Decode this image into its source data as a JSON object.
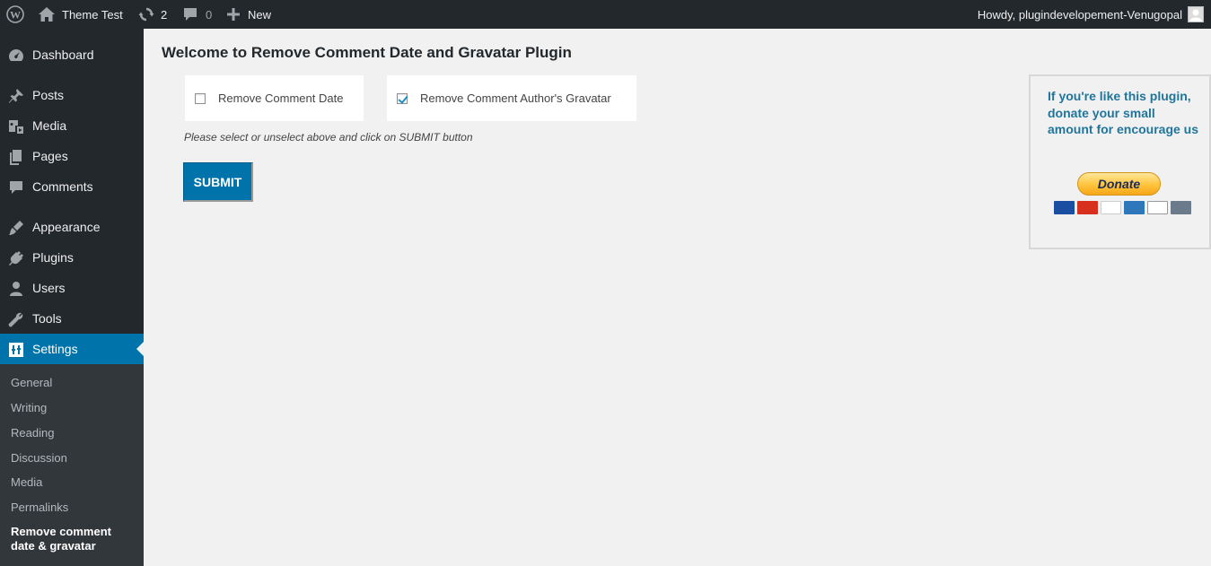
{
  "adminbar": {
    "site_name": "Theme Test",
    "updates_count": "2",
    "comments_count": "0",
    "new_label": "New",
    "howdy": "Howdy, plugindevelopement-Venugopal"
  },
  "sidebar": {
    "items": [
      {
        "label": "Dashboard",
        "icon": "dashboard-icon"
      },
      {
        "label": "Posts",
        "icon": "pin-icon"
      },
      {
        "label": "Media",
        "icon": "media-icon"
      },
      {
        "label": "Pages",
        "icon": "pages-icon"
      },
      {
        "label": "Comments",
        "icon": "comment-icon"
      },
      {
        "label": "Appearance",
        "icon": "brush-icon"
      },
      {
        "label": "Plugins",
        "icon": "plug-icon"
      },
      {
        "label": "Users",
        "icon": "user-icon"
      },
      {
        "label": "Tools",
        "icon": "wrench-icon"
      },
      {
        "label": "Settings",
        "icon": "settings-icon"
      }
    ],
    "submenu": [
      "General",
      "Writing",
      "Reading",
      "Discussion",
      "Media",
      "Permalinks",
      "Remove comment date & gravatar"
    ]
  },
  "main": {
    "title": "Welcome to Remove Comment Date and Gravatar Plugin",
    "options": [
      {
        "label": "Remove Comment Date",
        "checked": false
      },
      {
        "label": "Remove Comment Author's Gravatar",
        "checked": true
      }
    ],
    "help": "Please select or unselect above and click on SUBMIT button",
    "submit_label": "SUBMIT"
  },
  "donate": {
    "text": "If you're like this plugin, donate your small amount for encourage us",
    "button": "Donate"
  },
  "colors": {
    "adminbar_bg": "#23282d",
    "accent": "#0073aa",
    "link": "#21759b"
  }
}
